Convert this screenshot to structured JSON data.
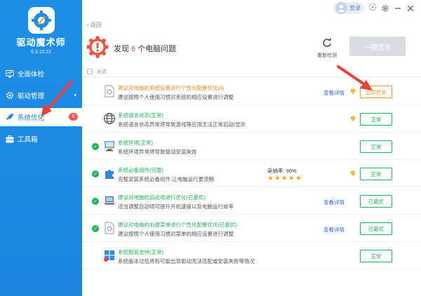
{
  "app": {
    "name": "驱动魔术师",
    "version": "9.3.10.22"
  },
  "sidebar": {
    "items": [
      {
        "label": "全面体检"
      },
      {
        "label": "驱动管理"
      },
      {
        "label": "系统优化",
        "badge": "6"
      },
      {
        "label": "工具箱"
      }
    ]
  },
  "topbar": {
    "login_label": "登录"
  },
  "header": {
    "back_label": "返回",
    "title_prefix": "发现",
    "problem_count": "6",
    "title_suffix": "个电脑问题",
    "rescan_label": "重新检测",
    "onekey_label": "一键优化"
  },
  "select_all_label": "全选",
  "rows": [
    {
      "title": "建议对电脑的系统设置进行个性化配置优化(6)",
      "desc": "建议按照个人使用习惯对系统的相应设置进行调整",
      "detail": "查看详情",
      "button": "立即优化",
      "icon": "settings-file-icon"
    },
    {
      "title": "系统语言状态(正常)",
      "desc": "系统语言状态异常将导致游戏等应用无法正常启动/显示",
      "button": "正常",
      "icon": "globe-icon"
    },
    {
      "title": "系统环境(正常)",
      "desc": "系统环境异常将导致驱动安装失败",
      "button": "正常",
      "icon": "computer-icon"
    },
    {
      "title": "系统必备组件(完整)",
      "desc": "完整安装系统必备组件,让电脑运行更流畅",
      "extra": "采纳率: 96%",
      "stars": "★★★★★",
      "rating": 4.5,
      "button": "正常",
      "icon": "puzzle-icon"
    },
    {
      "title": "建议对电脑的启动项进行优化(已最优)",
      "desc": "适当调整自动项可提升开机速度以及电脑运行效率",
      "detail": "查看详情",
      "button": "已最优",
      "icon": "laptop-icon"
    },
    {
      "title": "建议对电脑的右键菜单进行个性化配置优化(已最优)",
      "desc": "建议按照个人使用习惯对菜单的相应设置进行调整",
      "detail": "查看详情",
      "button": "已最优",
      "icon": "settings-file-icon"
    },
    {
      "title": "系统服务支持(正常)",
      "desc": "系统版本过低将有可能出现驱动无法适配或安装失败等情况",
      "button": "正常",
      "icon": "windows-icon"
    }
  ],
  "colors": {
    "accent": "#1f8fe6",
    "warning": "#f08a1f",
    "success": "#22b15d",
    "alert": "#f0533d"
  }
}
